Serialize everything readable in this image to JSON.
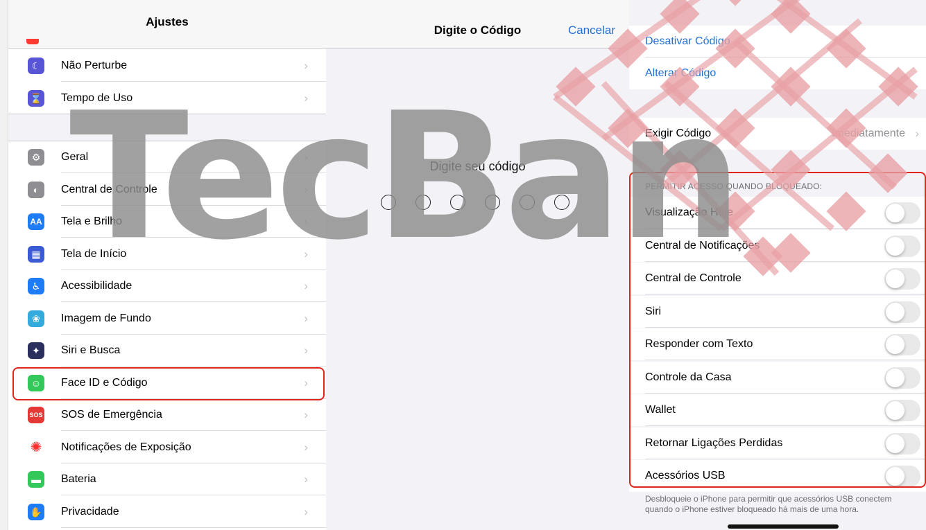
{
  "settings": {
    "title": "Ajustes",
    "rows_top": [
      {
        "label": "Não Perturbe",
        "icon": "moon-icon",
        "color": "#5856d6",
        "glyph": "☾"
      },
      {
        "label": "Tempo de Uso",
        "icon": "hourglass-icon",
        "color": "#5856d6",
        "glyph": "⌛"
      }
    ],
    "rows": [
      {
        "label": "Geral",
        "icon": "gear-icon",
        "color": "#8e8e93",
        "glyph": "⚙"
      },
      {
        "label": "Central de Controle",
        "icon": "switches-icon",
        "color": "#8e8e93",
        "glyph": "◐"
      },
      {
        "label": "Tela e Brilho",
        "icon": "display-brightness-icon",
        "color": "#1e7cf6",
        "glyph": "AA"
      },
      {
        "label": "Tela de Início",
        "icon": "home-screen-grid-icon",
        "color": "#3a5ad6",
        "glyph": "▦"
      },
      {
        "label": "Acessibilidade",
        "icon": "accessibility-icon",
        "color": "#1e7cf6",
        "glyph": "♿"
      },
      {
        "label": "Imagem de Fundo",
        "icon": "wallpaper-flower-icon",
        "color": "#35aadc",
        "glyph": "❀"
      },
      {
        "label": "Siri e Busca",
        "icon": "siri-icon",
        "color": "#2b2f5e",
        "glyph": "✦"
      },
      {
        "label": "Face ID e Código",
        "icon": "face-id-icon",
        "color": "#34c759",
        "glyph": "☺"
      },
      {
        "label": "SOS de Emergência",
        "icon": "sos-icon",
        "color": "#e53935",
        "glyph": "SOS"
      },
      {
        "label": "Notificações de Exposição",
        "icon": "exposure-notification-icon",
        "color": "#ffffff",
        "glyph": "✺"
      },
      {
        "label": "Bateria",
        "icon": "battery-icon",
        "color": "#34c759",
        "glyph": "▬"
      },
      {
        "label": "Privacidade",
        "icon": "privacy-hand-icon",
        "color": "#1e7cf6",
        "glyph": "✋"
      }
    ]
  },
  "passcode": {
    "title": "Digite o Código",
    "cancel": "Cancelar",
    "prompt": "Digite seu código",
    "digits": 6
  },
  "options": {
    "disable_code": "Desativar Código",
    "change_code": "Alterar Código",
    "require_label": "Exigir Código",
    "require_value": "Imediatamente",
    "section_header": "PERMITIR ACESSO QUANDO BLOQUEADO:",
    "toggles": [
      {
        "label": "Visualização Hoje",
        "on": false
      },
      {
        "label": "Central de Notificações",
        "on": false
      },
      {
        "label": "Central de Controle",
        "on": false
      },
      {
        "label": "Siri",
        "on": false
      },
      {
        "label": "Responder com Texto",
        "on": false
      },
      {
        "label": "Controle da Casa",
        "on": false
      },
      {
        "label": "Wallet",
        "on": false
      },
      {
        "label": "Retornar Ligações Perdidas",
        "on": false
      },
      {
        "label": "Acessórios USB",
        "on": false
      }
    ],
    "footer": "Desbloqueie o iPhone para permitir que acessórios USB conectem quando o iPhone estiver bloqueado há mais de uma hora."
  },
  "watermark": {
    "text": "TecBan",
    "color": "#e8a0a4"
  },
  "colors": {
    "link_blue": "#1f6fd6",
    "highlight_red": "#e0251b"
  }
}
